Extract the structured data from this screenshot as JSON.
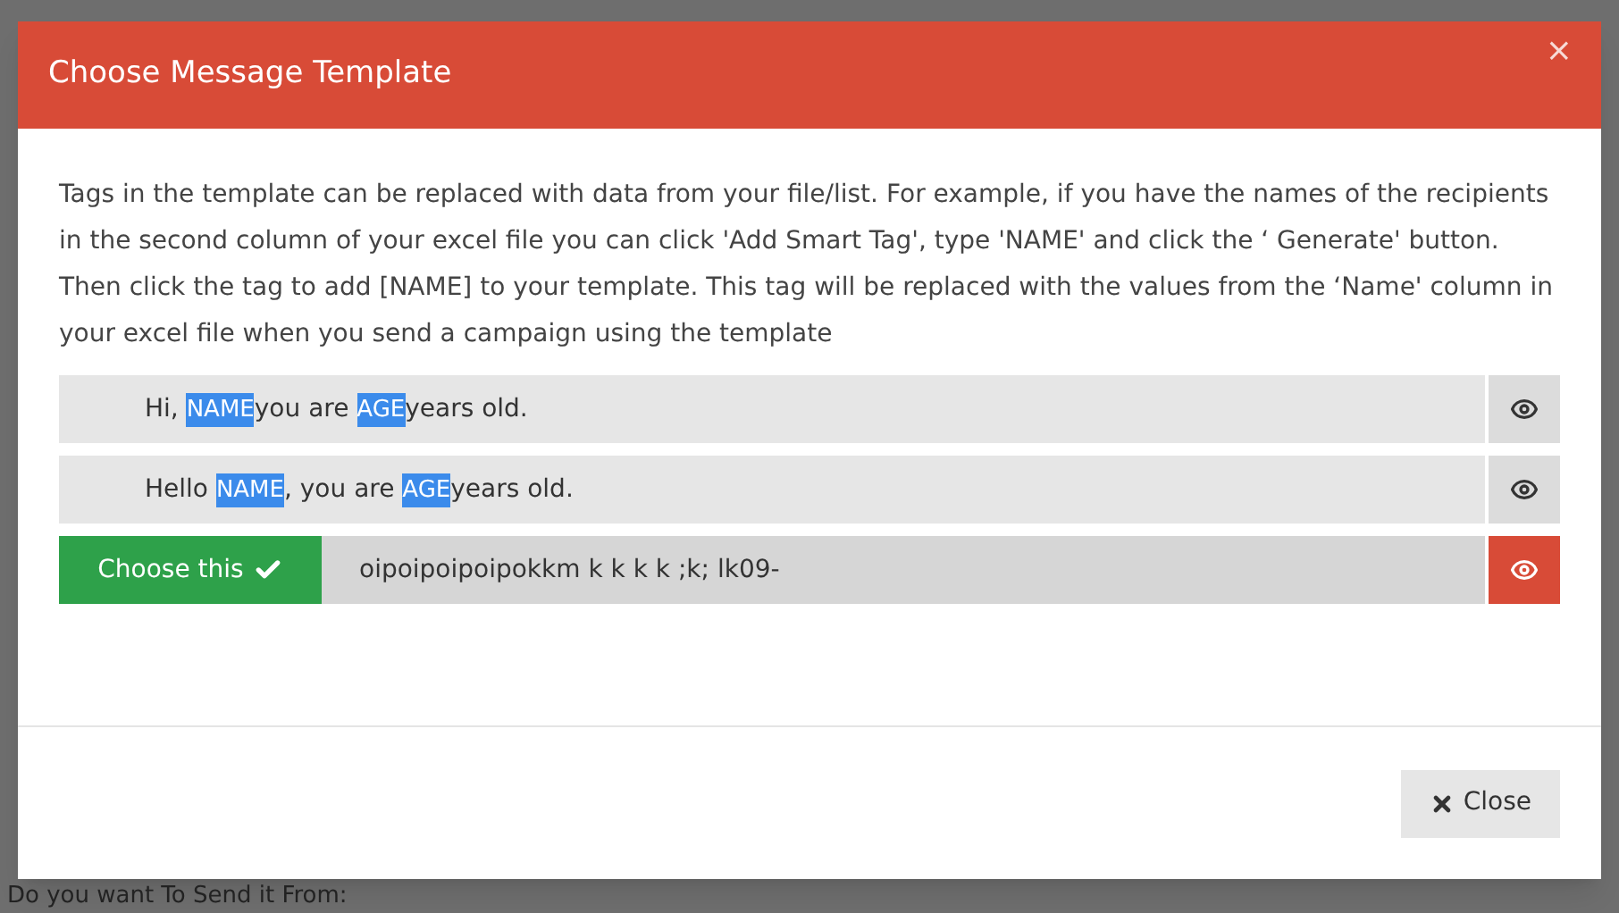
{
  "dialog": {
    "title": "Choose Message Template",
    "close_symbol": "×",
    "description": "Tags in the template can be replaced with data from your file/list. For example, if you have the names of the recipients in the second column of your excel file you can click 'Add Smart Tag', type 'NAME' and click the ‘ Generate' button. Then click the tag to add [NAME] to your template. This tag will be replaced with the values from the ‘Name' column in your excel file when you send a campaign using the template",
    "templates": [
      {
        "selected": false,
        "parts": [
          {
            "kind": "text",
            "text": "Hi, "
          },
          {
            "kind": "tag",
            "text": "NAME"
          },
          {
            "kind": "text",
            "text": "you are "
          },
          {
            "kind": "tag",
            "text": "AGE"
          },
          {
            "kind": "text",
            "text": "years old."
          }
        ]
      },
      {
        "selected": false,
        "parts": [
          {
            "kind": "text",
            "text": "Hello "
          },
          {
            "kind": "tag",
            "text": "NAME"
          },
          {
            "kind": "text",
            "text": ", you are "
          },
          {
            "kind": "tag",
            "text": "AGE"
          },
          {
            "kind": "text",
            "text": "years old."
          }
        ]
      },
      {
        "selected": true,
        "choose_label": "Choose this",
        "parts": [
          {
            "kind": "text",
            "text": "oipoipoipoipokkm k k k k ;k; lk09-"
          }
        ]
      }
    ],
    "close_button": "Close"
  },
  "background_text": "Do you want To Send it From:"
}
